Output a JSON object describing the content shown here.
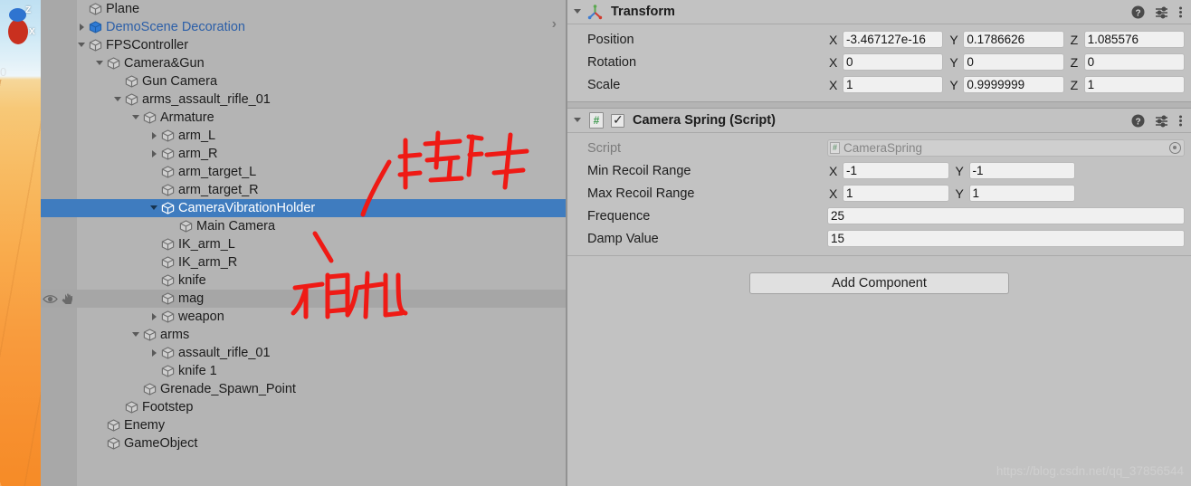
{
  "scene_view": {
    "gizmo": {
      "z_label": "Z",
      "x_label": "X"
    },
    "origin_label": "0"
  },
  "hierarchy": {
    "expand_chevron": "chevron-right-icon",
    "rows": [
      {
        "label": "Plane",
        "depth": 1,
        "twisty": "none",
        "state": "normal",
        "prefab": false
      },
      {
        "label": "DemoScene Decoration",
        "depth": 1,
        "twisty": "closed",
        "state": "normal",
        "prefab": true
      },
      {
        "label": "FPSController",
        "depth": 1,
        "twisty": "open",
        "state": "normal",
        "prefab": false
      },
      {
        "label": "Camera&Gun",
        "depth": 2,
        "twisty": "open",
        "state": "normal",
        "prefab": false
      },
      {
        "label": "Gun Camera",
        "depth": 3,
        "twisty": "none",
        "state": "normal",
        "prefab": false
      },
      {
        "label": "arms_assault_rifle_01",
        "depth": 3,
        "twisty": "open",
        "state": "normal",
        "prefab": false
      },
      {
        "label": "Armature",
        "depth": 4,
        "twisty": "open",
        "state": "normal",
        "prefab": false
      },
      {
        "label": "arm_L",
        "depth": 5,
        "twisty": "closed",
        "state": "normal",
        "prefab": false
      },
      {
        "label": "arm_R",
        "depth": 5,
        "twisty": "closed",
        "state": "normal",
        "prefab": false
      },
      {
        "label": "arm_target_L",
        "depth": 5,
        "twisty": "none",
        "state": "normal",
        "prefab": false
      },
      {
        "label": "arm_target_R",
        "depth": 5,
        "twisty": "none",
        "state": "normal",
        "prefab": false
      },
      {
        "label": "CameraVibrationHolder",
        "depth": 5,
        "twisty": "open",
        "state": "selected",
        "prefab": false
      },
      {
        "label": "Main Camera",
        "depth": 6,
        "twisty": "none",
        "state": "normal",
        "prefab": false
      },
      {
        "label": "IK_arm_L",
        "depth": 5,
        "twisty": "none",
        "state": "normal",
        "prefab": false
      },
      {
        "label": "IK_arm_R",
        "depth": 5,
        "twisty": "none",
        "state": "normal",
        "prefab": false
      },
      {
        "label": "knife",
        "depth": 5,
        "twisty": "none",
        "state": "normal",
        "prefab": false
      },
      {
        "label": "mag",
        "depth": 5,
        "twisty": "none",
        "state": "hovered",
        "prefab": false
      },
      {
        "label": "weapon",
        "depth": 5,
        "twisty": "closed",
        "state": "normal",
        "prefab": false
      },
      {
        "label": "arms",
        "depth": 4,
        "twisty": "open",
        "state": "normal",
        "prefab": false
      },
      {
        "label": "assault_rifle_01",
        "depth": 5,
        "twisty": "closed",
        "state": "normal",
        "prefab": false
      },
      {
        "label": "knife 1",
        "depth": 5,
        "twisty": "none",
        "state": "normal",
        "prefab": false
      },
      {
        "label": "Grenade_Spawn_Point",
        "depth": 4,
        "twisty": "none",
        "state": "normal",
        "prefab": false
      },
      {
        "label": "Footstep",
        "depth": 3,
        "twisty": "none",
        "state": "normal",
        "prefab": false
      },
      {
        "label": "Enemy",
        "depth": 2,
        "twisty": "none",
        "state": "normal",
        "prefab": false
      },
      {
        "label": "GameObject",
        "depth": 2,
        "twisty": "none",
        "state": "normal",
        "prefab": false
      }
    ],
    "visibility_icons": {
      "eye": "eye-icon",
      "hand": "hand-icon"
    }
  },
  "annotations": [
    {
      "id": "annotation-attach-script",
      "text": "挂脚本",
      "meaning": "attach-script"
    },
    {
      "id": "annotation-camera",
      "text": "相机",
      "meaning": "camera"
    }
  ],
  "inspector": {
    "transform": {
      "title": "Transform",
      "icon": "transform-axis-icon",
      "header_icons": [
        "help-icon",
        "preset-icon",
        "more-menu-icon"
      ],
      "rows": [
        {
          "label": "Position",
          "axes": [
            "X",
            "Y",
            "Z"
          ],
          "values": [
            "-3.467127e-16",
            "0.1786626",
            "1.085576"
          ]
        },
        {
          "label": "Rotation",
          "axes": [
            "X",
            "Y",
            "Z"
          ],
          "values": [
            "0",
            "0",
            "0"
          ]
        },
        {
          "label": "Scale",
          "axes": [
            "X",
            "Y",
            "Z"
          ],
          "values": [
            "1",
            "0.9999999",
            "1"
          ]
        }
      ]
    },
    "camera_spring": {
      "title": "Camera Spring (Script)",
      "icon": "csharp-script-icon",
      "enabled": true,
      "header_icons": [
        "help-icon",
        "preset-icon",
        "more-menu-icon"
      ],
      "script_row": {
        "label": "Script",
        "value": "CameraSpring"
      },
      "vec_rows": [
        {
          "label": "Min Recoil Range",
          "axes": [
            "X",
            "Y"
          ],
          "values": [
            "-1",
            "-1"
          ]
        },
        {
          "label": "Max Recoil Range",
          "axes": [
            "X",
            "Y"
          ],
          "values": [
            "1",
            "1"
          ]
        }
      ],
      "scalar_rows": [
        {
          "label": "Frequence",
          "value": "25"
        },
        {
          "label": "Damp Value",
          "value": "15"
        }
      ]
    },
    "add_component_label": "Add Component"
  },
  "watermark": "https://blog.csdn.net/qq_37856544",
  "colors": {
    "selection_blue": "#3f7cbf",
    "prefab_blue": "#2c5fa8",
    "panel_gray": "#c2c2c2",
    "hierarchy_gray": "#b4b4b4",
    "annotation_red": "#ef1a15"
  }
}
